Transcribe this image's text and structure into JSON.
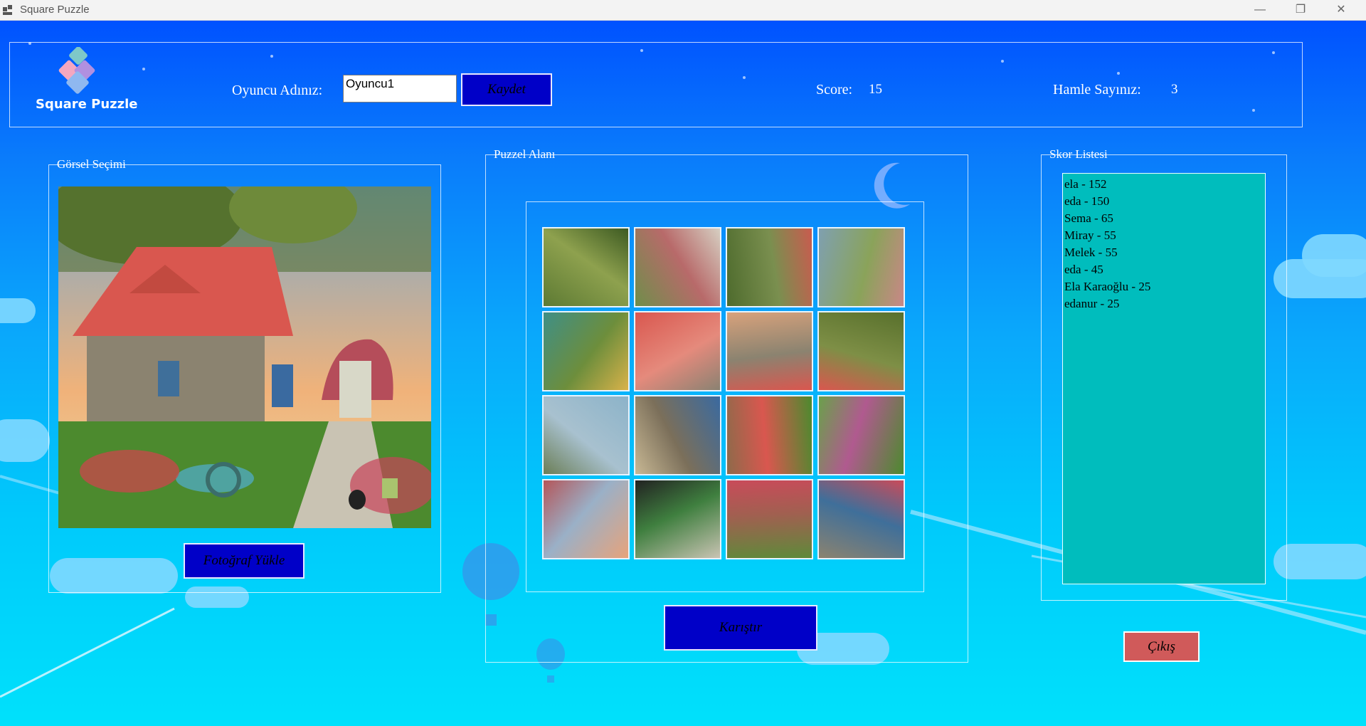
{
  "window": {
    "title": "Square Puzzle",
    "minimize_icon": "minimize-icon",
    "restore_icon": "restore-icon",
    "close_icon": "close-icon"
  },
  "header": {
    "logo_text": "Square Puzzle",
    "player_label": "Oyuncu Adınız:",
    "player_value": "Oyuncu1",
    "save_button": "Kaydet",
    "score_label": "Score:",
    "score_value": "15",
    "moves_label": "Hamle Sayınız:",
    "moves_value": "3"
  },
  "image_panel": {
    "caption": "Görsel Seçimi",
    "upload_button": "Fotoğraf Yükle"
  },
  "puzzle_panel": {
    "caption": "Puzzel Alanı",
    "shuffle_button": "Karıştır",
    "grid_rows": 4,
    "grid_cols": 4
  },
  "score_panel": {
    "caption": "Skor Listesi",
    "entries": [
      "ela - 152",
      "eda - 150",
      "Sema - 65",
      "Miray - 55",
      "Melek - 55",
      "eda - 45",
      "Ela Karaoğlu - 25",
      "edanur - 25"
    ]
  },
  "exit_button": "Çıkış",
  "colors": {
    "button_blue": "#0000c8",
    "exit_red": "#d05a5a",
    "score_list_bg": "#00bdbd"
  }
}
